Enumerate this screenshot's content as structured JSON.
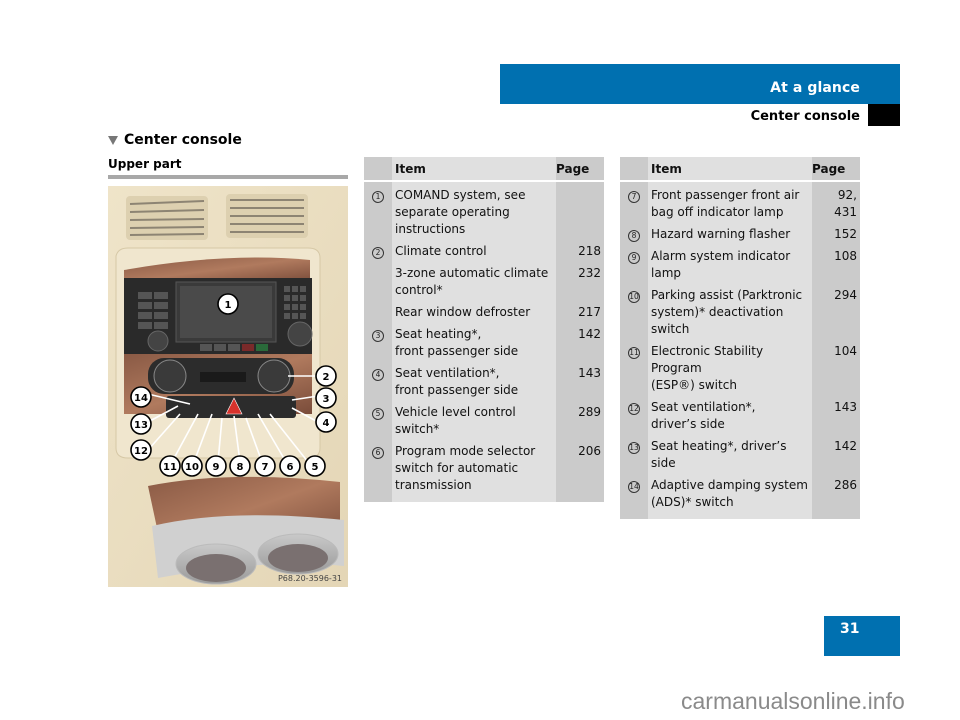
{
  "header": {
    "chapter": "At a glance",
    "section": "Center console"
  },
  "section_title": "Center console",
  "subsection_title": "Upper part",
  "photo": {
    "code": "P68.20-3596-31",
    "callouts": [
      "1",
      "2",
      "3",
      "4",
      "5",
      "6",
      "7",
      "8",
      "9",
      "10",
      "11",
      "12",
      "13",
      "14"
    ]
  },
  "tables": [
    {
      "headers": {
        "num": "",
        "item": "Item",
        "page": "Page"
      },
      "rows": [
        {
          "num": "1",
          "item": "COMAND system, see\nseparate operating\ninstructions",
          "page": ""
        },
        {
          "num": "2",
          "item": "Climate control",
          "page": "218"
        },
        {
          "num": "",
          "item": "3-zone automatic climate\ncontrol*",
          "page": "232"
        },
        {
          "num": "",
          "item": "Rear window defroster",
          "page": "217"
        },
        {
          "num": "3",
          "item": "Seat heating*,\nfront passenger side",
          "page": "142"
        },
        {
          "num": "4",
          "item": "Seat ventilation*,\nfront passenger side",
          "page": "143"
        },
        {
          "num": "5",
          "item": "Vehicle level control\nswitch*",
          "page": "289"
        },
        {
          "num": "6",
          "item": "Program mode selector\nswitch for automatic\ntransmission",
          "page": "206"
        }
      ]
    },
    {
      "headers": {
        "num": "",
        "item": "Item",
        "page": "Page"
      },
      "rows": [
        {
          "num": "7",
          "item": "Front passenger front air\nbag off indicator lamp",
          "page": "92,\n431"
        },
        {
          "num": "8",
          "item": "Hazard warning flasher",
          "page": "152"
        },
        {
          "num": "9",
          "item": "Alarm system indicator\nlamp",
          "page": "108"
        },
        {
          "num": "10",
          "item": "Parking assist (Parktronic\nsystem)* deactivation\nswitch",
          "page": "294"
        },
        {
          "num": "11",
          "item": "Electronic Stability Program\n(ESP®) switch",
          "page": "104"
        },
        {
          "num": "12",
          "item": "Seat ventilation*,\ndriver’s side",
          "page": "143"
        },
        {
          "num": "13",
          "item": "Seat heating*, driver’s side",
          "page": "142"
        },
        {
          "num": "14",
          "item": "Adaptive damping system\n(ADS)* switch",
          "page": "286"
        }
      ]
    }
  ],
  "page_number": "31",
  "watermark": "carmanualsonline.info",
  "colors": {
    "brand_blue": "#0070b0",
    "table_dark": "#cbcbcb",
    "table_light": "#e0e0e0"
  }
}
